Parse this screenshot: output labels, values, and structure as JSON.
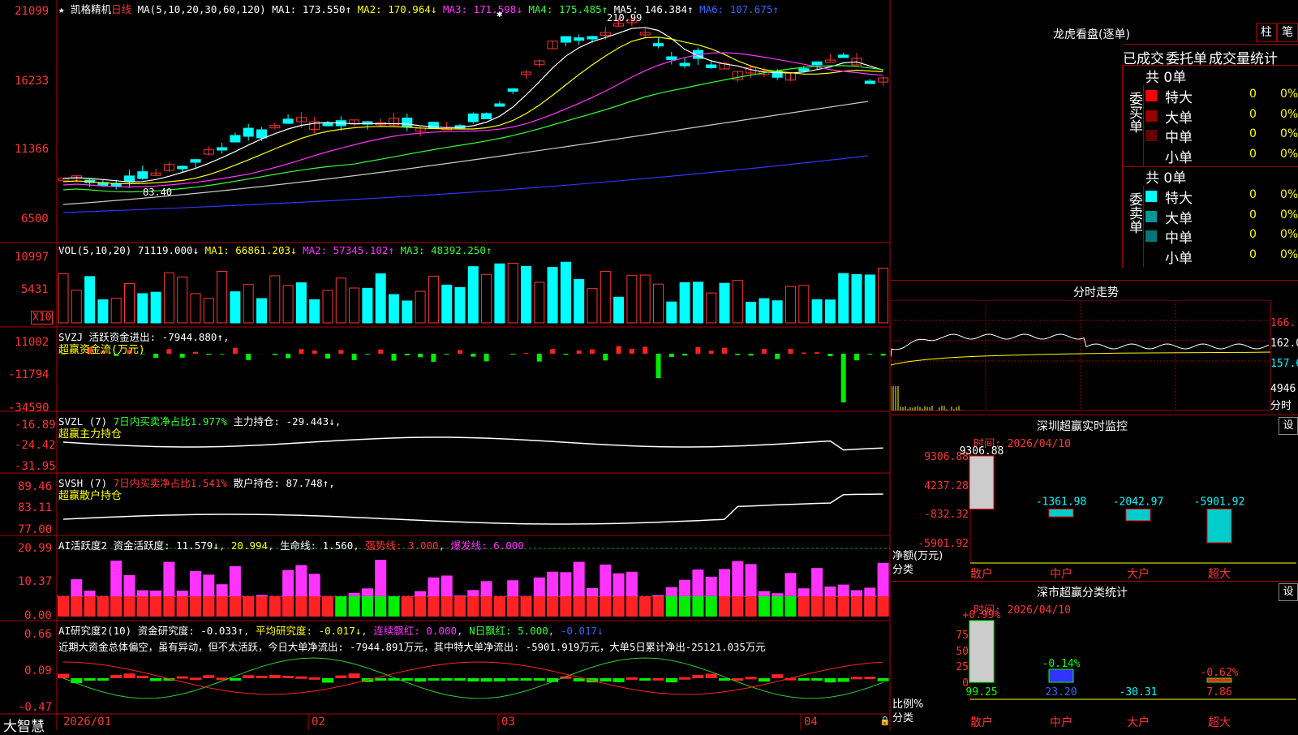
{
  "stock": {
    "name": "凯格精机",
    "period": "日线"
  },
  "ma_header": {
    "label": "MA(5,10,20,30,60,120)",
    "ma1": "MA1: 173.550↑",
    "ma2": "MA2: 170.964↓",
    "ma3": "MA3: 171.598↓",
    "ma4": "MA4: 175.485↑",
    "ma5": "MA5: 146.384↑",
    "ma6": "MA6: 107.675↑"
  },
  "price_axis": [
    "21099",
    "16233",
    "11366",
    "6500"
  ],
  "price_markers": {
    "high": "210.99",
    "low": "83.40"
  },
  "vol_header": {
    "label": "VOL(5,10,20)",
    "v": "71119.000↓",
    "ma1": "MA1: 66861.203↓",
    "ma2": "MA2: 57345.102↑",
    "ma3": "MA3: 48392.250↑"
  },
  "vol_axis": [
    "10997",
    "5431"
  ],
  "vol_unit": "X10",
  "svzj": {
    "label": "SVZJ",
    "text": "活跃资金进出: -7944.880↑,",
    "sub": "超赢资金流(万元)",
    "axis": [
      "11002",
      "-11794",
      "-34590"
    ]
  },
  "svzl": {
    "label": "SVZL (7)",
    "text1": "7日内买卖净占比1.977%",
    "text2": "主力持仓: -29.443↓,",
    "sub": "超赢主力持仓",
    "axis": [
      "-16.89",
      "-24.42",
      "-31.95"
    ]
  },
  "svsh": {
    "label": "SVSH (7)",
    "text1": "7日内买卖净占比1.541%",
    "text2": "散户持仓: 87.748↑,",
    "sub": "超赢散户持仓",
    "axis": [
      "89.46",
      "83.11",
      "77.00"
    ]
  },
  "ai_active": {
    "label": "AI活跃度2",
    "v1": "资金活跃度: 11.579↓",
    "v2": "20.994",
    "v3": "生命线: 1.560",
    "v4": "强势线: 3.000",
    "v5": "爆发线: 6.000",
    "axis": [
      "20.99",
      "10.37",
      "0.00"
    ]
  },
  "ai_research": {
    "label": "AI研究度2(10)",
    "v1": "资金研究度: -0.033↑",
    "v2": "平均研究度: -0.017↓",
    "v3": "连续飘红: 0.000",
    "v4": "N日飘红: 5.000",
    "v5": "-0.017↓",
    "note": "近期大资金总体偏空，虽有异动，但不太活跃，今日大单净流出: -7944.891万元，其中特大单净流出: -5901.919万元，大单5日累计净出-25121.035万元",
    "axis": [
      "0.66",
      "0.09",
      "-0.47"
    ]
  },
  "date_axis": [
    "2026/01",
    "02",
    "03",
    "04"
  ],
  "brand": "大智慧",
  "dragon": {
    "title": "龙虎看盘(逐单)",
    "btn1": "柱",
    "btn2": "笔",
    "tabs": [
      "已成交",
      "委托单",
      "成交量统计"
    ],
    "buy_label": "委买单",
    "sell_label": "委卖单",
    "buy_total": "共 0单",
    "sell_total": "共 0单",
    "buy_rows": [
      {
        "name": "特大",
        "n": "0",
        "p": "0%",
        "color": "#ff0000"
      },
      {
        "name": "大单",
        "n": "0",
        "p": "0%",
        "color": "#990000"
      },
      {
        "name": "中单",
        "n": "0",
        "p": "0%",
        "color": "#660000"
      },
      {
        "name": "小单",
        "n": "0",
        "p": "0%",
        "color": "#000000"
      }
    ],
    "sell_rows": [
      {
        "name": "特大",
        "n": "0",
        "p": "0%",
        "color": "#00ffff"
      },
      {
        "name": "大单",
        "n": "0",
        "p": "0%",
        "color": "#009999"
      },
      {
        "name": "中单",
        "n": "0",
        "p": "0%",
        "color": "#007777"
      },
      {
        "name": "小单",
        "n": "0",
        "p": "0%",
        "color": "#000000"
      }
    ]
  },
  "intraday": {
    "title": "分时走势",
    "axis": [
      "166.",
      "162.0",
      "157.6",
      "4946"
    ],
    "unit": "分时"
  },
  "sz_monitor": {
    "title": "深圳超赢实时监控",
    "btn": "设",
    "date": "时间: 2026/04/10",
    "axis": [
      "9306.88",
      "4237.28",
      "-832.32",
      "-5901.92"
    ],
    "ylabel": "净额(万元)",
    "xlabel": "分类",
    "categories": [
      "散户",
      "中户",
      "大户",
      "超大"
    ],
    "values": [
      9306.88,
      -1361.98,
      -2042.97,
      -5901.92
    ],
    "labels": [
      "9306.88",
      "-1361.98",
      "-2042.97",
      "-5901.92"
    ]
  },
  "sz_class": {
    "title": "深市超赢分类统计",
    "btn": "设",
    "date": "时间: 2026/04/10",
    "axis": [
      "75",
      "50",
      "25",
      "0"
    ],
    "ylabel": "比例%",
    "xlabel": "分类",
    "categories": [
      "散户",
      "中户",
      "大户",
      "超大"
    ],
    "top_labels": [
      "+0.99%",
      "-0.14%",
      "",
      "-0.62%"
    ],
    "bottom_values": [
      "99.25",
      "23.20",
      "-30.31",
      "7.86"
    ]
  }
}
